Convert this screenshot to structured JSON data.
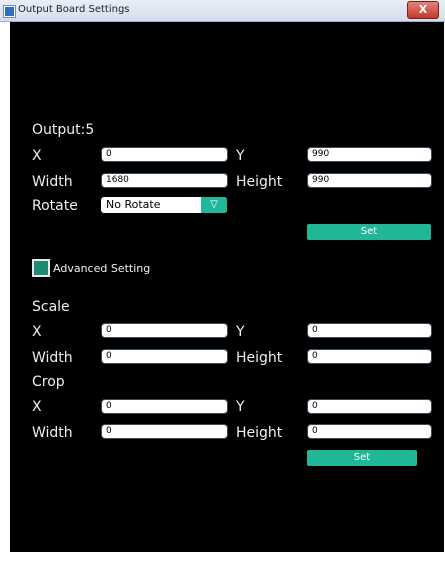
{
  "window": {
    "title": "Output Board Settings",
    "close_label": "X"
  },
  "output": {
    "heading": "Output:5",
    "x_label": "X",
    "x_value": "0",
    "y_label": "Y",
    "y_value": "990",
    "width_label": "Width",
    "width_value": "1680",
    "height_label": "Height",
    "height_value": "990",
    "rotate_label": "Rotate",
    "rotate_value": "No Rotate",
    "set_label": "Set"
  },
  "advanced": {
    "label": "Advanced Setting",
    "checked": true
  },
  "scale": {
    "heading": "Scale",
    "x_label": "X",
    "x_value": "0",
    "y_label": "Y",
    "y_value": "0",
    "width_label": "Width",
    "width_value": "0",
    "height_label": "Height",
    "height_value": "0"
  },
  "crop": {
    "heading": "Crop",
    "x_label": "X",
    "x_value": "0",
    "y_label": "Y",
    "y_value": "0",
    "width_label": "Width",
    "width_value": "0",
    "height_label": "Height",
    "height_value": "0",
    "set_label": "Set"
  },
  "colors": {
    "accent": "#1fb796",
    "panel_bg": "#000000",
    "text": "#f0f0f0"
  },
  "icons": {
    "dropdown": "▽",
    "app": "app-icon"
  }
}
